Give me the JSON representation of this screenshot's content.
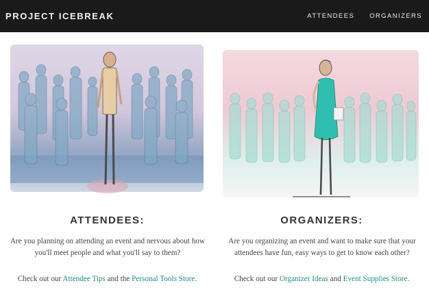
{
  "header": {
    "brand": "PROJECT ICEBREAK",
    "nav": [
      {
        "label": "ATTENDEES"
      },
      {
        "label": "ORGANIZERS"
      }
    ]
  },
  "attendees": {
    "heading": "ATTENDEES:",
    "description": "Are you planning on attending an event and nervous about how you'll meet people and what you'll say to them?",
    "links_prefix": "Check out our ",
    "link1": "Attendee Tips",
    "links_middle": " and the ",
    "link2": "Personal Tools Store",
    "links_suffix": "."
  },
  "organizers": {
    "heading": "ORGANIZERS:",
    "description": "Are you organizing an event and want to make sure that your attendees have fun, easy ways to get to know each other?",
    "links_prefix": "Check out our ",
    "link1": "Organizer Ideas",
    "links_middle": " and ",
    "link2": "Event Supplies Store",
    "links_suffix": "."
  },
  "colors": {
    "header_bg": "#1a1a1a",
    "link": "#1f8a7e",
    "attendee_crowd": "#7fa8c4",
    "organizer_dress": "#2fbfb0",
    "watercolor_pink": "#e8b7c3"
  }
}
